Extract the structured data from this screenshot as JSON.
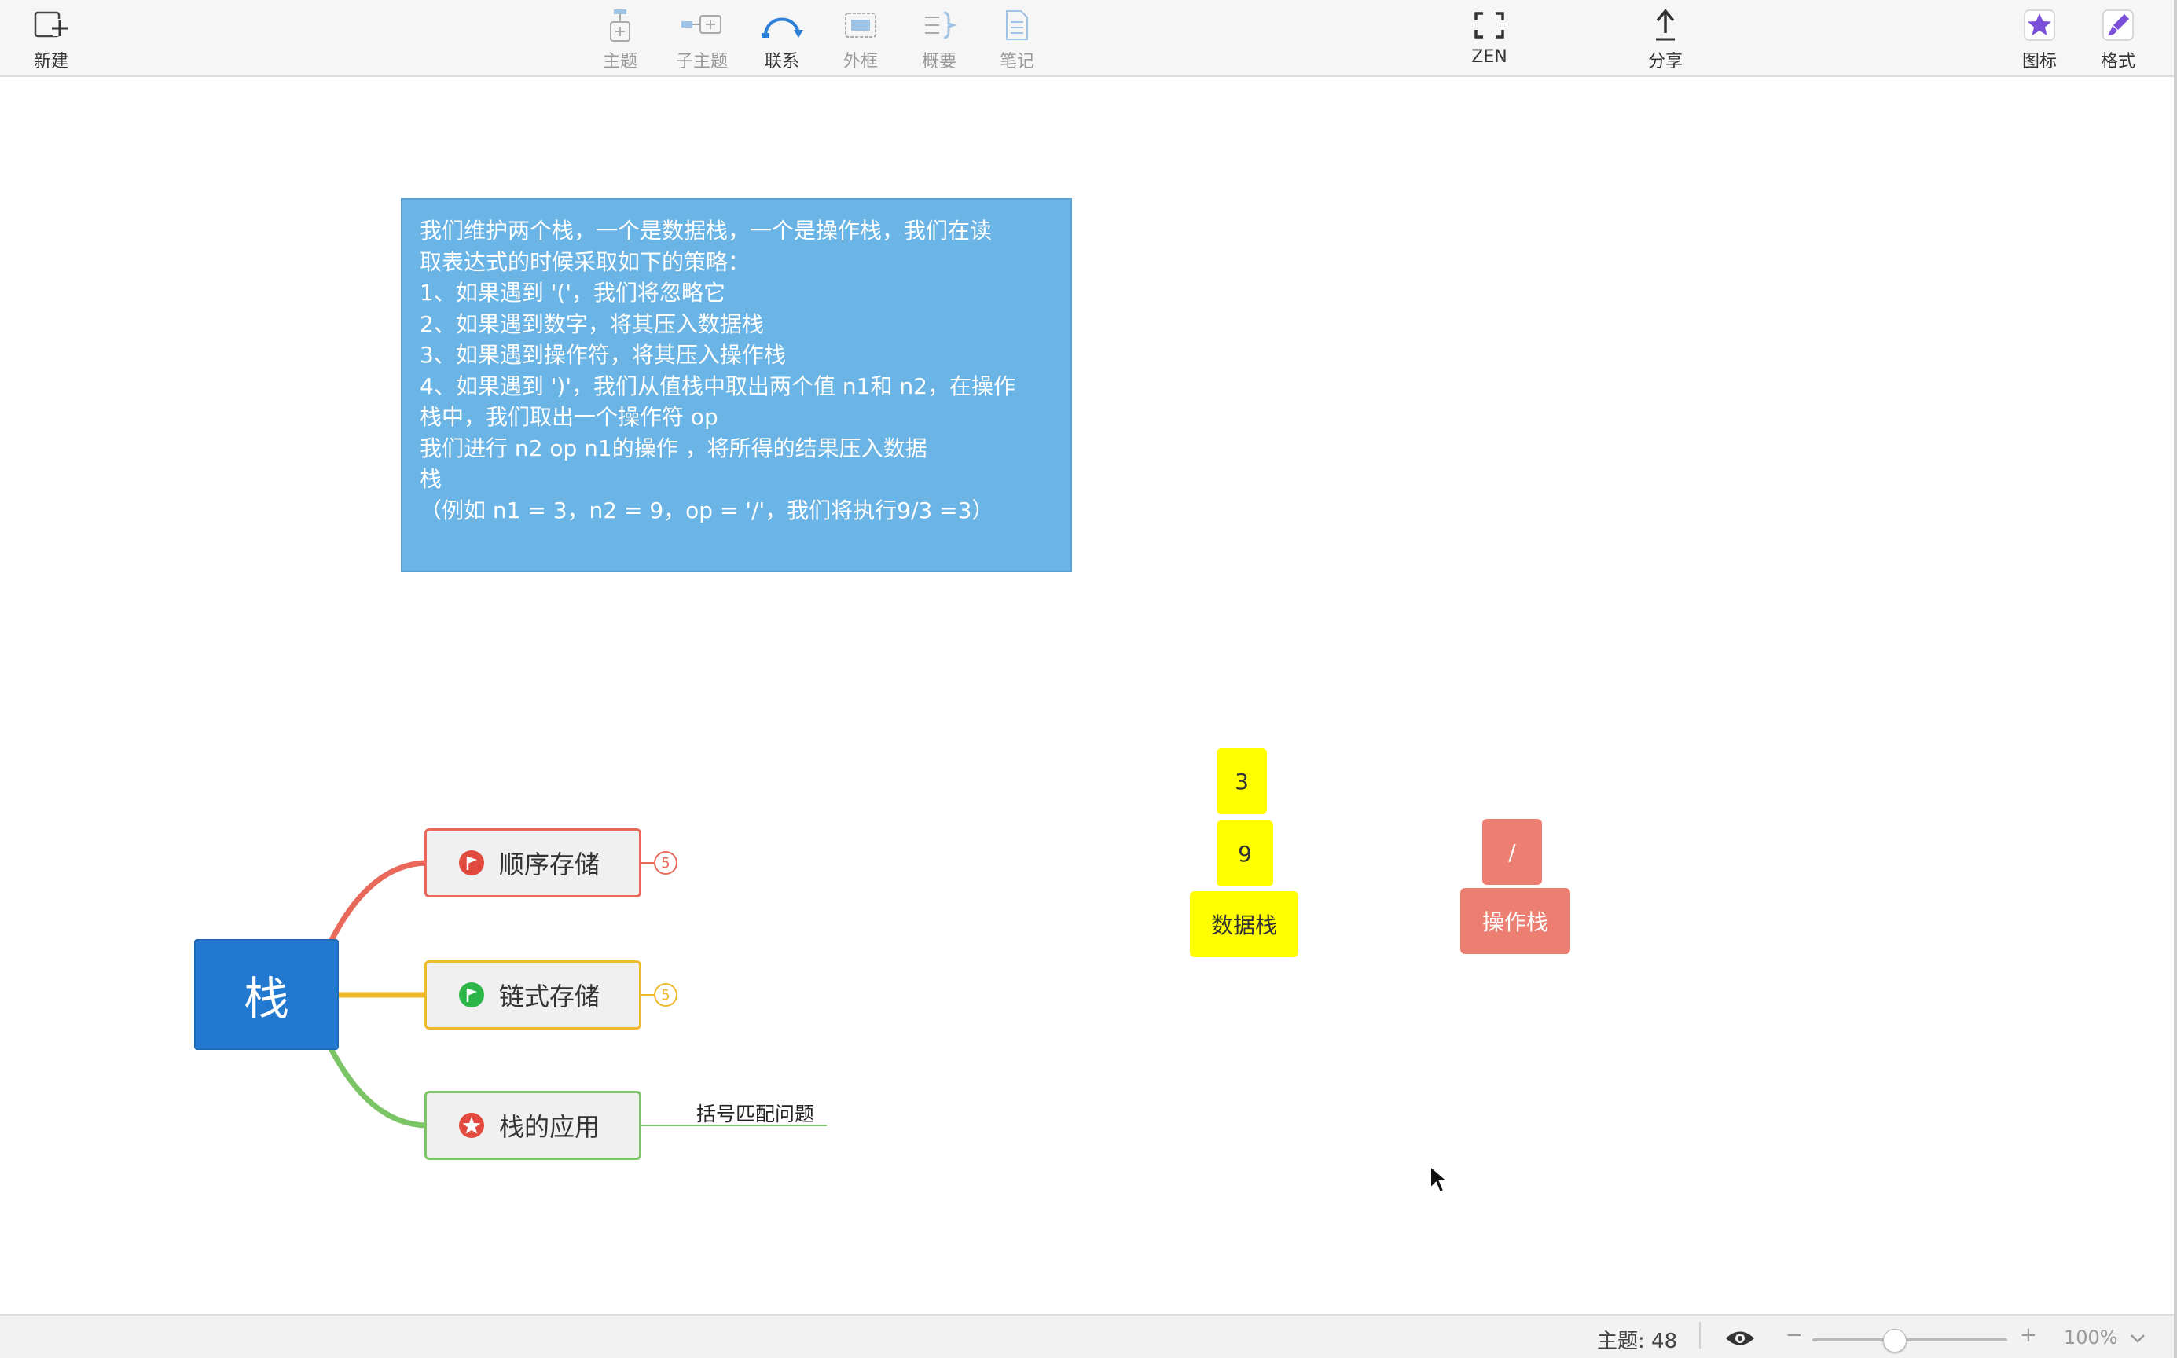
{
  "toolbar": {
    "new_label": "新建",
    "topic_label": "主题",
    "subtopic_label": "子主题",
    "relation_label": "联系",
    "boundary_label": "外框",
    "summary_label": "概要",
    "notes_label": "笔记",
    "zen_label": "ZEN",
    "share_label": "分享",
    "icons_label": "图标",
    "format_label": "格式"
  },
  "note": {
    "lines": [
      "我们维护两个栈，一个是数据栈，一个是操作栈，我们在读",
      "取表达式的时候采取如下的策略：",
      "1、如果遇到 '('，我们将忽略它",
      "2、如果遇到数字，将其压入数据栈",
      "3、如果遇到操作符，将其压入操作栈",
      "4、如果遇到 ')'，我们从值栈中取出两个值 n1和 n2，在操作",
      "栈中，我们取出一个操作符 op",
      "我们进行 n2 op n1的操作 ，将所得的结果压入数据",
      "栈",
      "（例如 n1 = 3，n2 = 9，op = '/'，我们将执行9/3 =3）"
    ]
  },
  "data_stack": {
    "items": [
      "3",
      "9"
    ],
    "label": "数据栈",
    "color": "#ffff00"
  },
  "op_stack": {
    "items": [
      "/"
    ],
    "label": "操作栈",
    "color": "#ec7e72"
  },
  "mindmap": {
    "root": "栈",
    "branches": [
      {
        "label": "顺序存储",
        "badge": "5",
        "color": "#e8685a",
        "icon": "red-flag-icon"
      },
      {
        "label": "链式存储",
        "badge": "5",
        "color": "#f0b92a",
        "icon": "green-flag-icon"
      },
      {
        "label": "栈的应用",
        "color": "#7cc566",
        "icon": "red-star-icon",
        "subtopic": "括号匹配问题"
      }
    ]
  },
  "statusbar": {
    "topic_count": "主题: 48",
    "zoom_minus": "−",
    "zoom_plus": "+",
    "zoom_level": "100%",
    "zoom_fraction": 0.42
  },
  "colors": {
    "root": "#2378d0",
    "note": "#6ab4e6",
    "accent_blue": "#2d7fd8"
  }
}
